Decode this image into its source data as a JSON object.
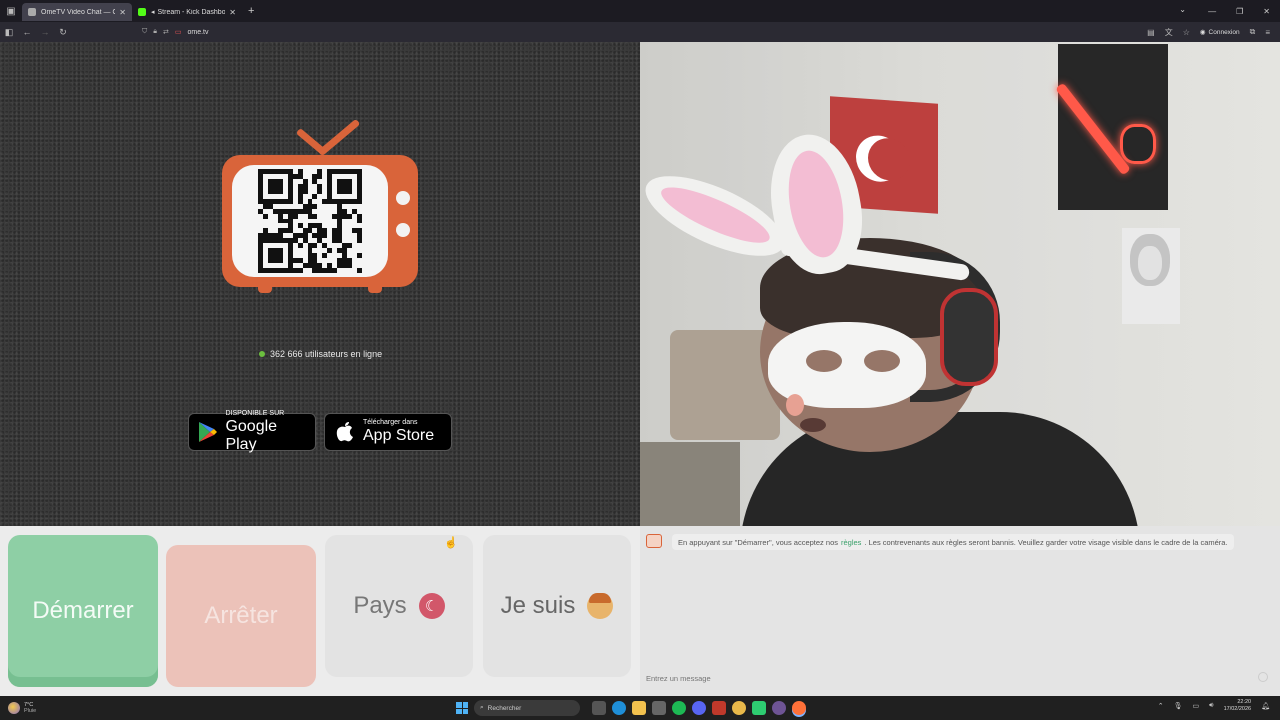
{
  "browser": {
    "tabs": [
      {
        "title": "OmeTV Video Chat — Omegle",
        "active": true
      },
      {
        "title": "Stream - Kick Dashboard",
        "active": false
      }
    ],
    "url": "ome.tv",
    "connexion_label": "Connexion"
  },
  "main": {
    "online_count": "362 666 utilisateurs en ligne",
    "google_play": {
      "small": "DISPONIBLE SUR",
      "big": "Google Play"
    },
    "app_store": {
      "small": "Télécharger dans",
      "big": "App Store"
    }
  },
  "controls": {
    "start_label": "Démarrer",
    "stop_label": "Arrêter",
    "country_label": "Pays",
    "gender_label": "Je suis"
  },
  "chat": {
    "notice_before": "En appuyant sur \"Démarrer\", vous acceptez nos",
    "notice_link": "règles",
    "notice_after": ". Les contrevenants aux règles seront bannis. Veuillez garder votre visage visible dans le cadre de la caméra.",
    "input_placeholder": "Entrez un message"
  },
  "taskbar": {
    "weather_temp": "7°C",
    "weather_desc": "Pluie",
    "search_placeholder": "Rechercher",
    "time": "22:20",
    "date": "17/02/2026"
  },
  "colors": {
    "accent_orange": "#d9643a",
    "start_green": "#8ecfa5",
    "stop_pink": "#ecc2b9",
    "online_dot": "#6cbf3f"
  }
}
